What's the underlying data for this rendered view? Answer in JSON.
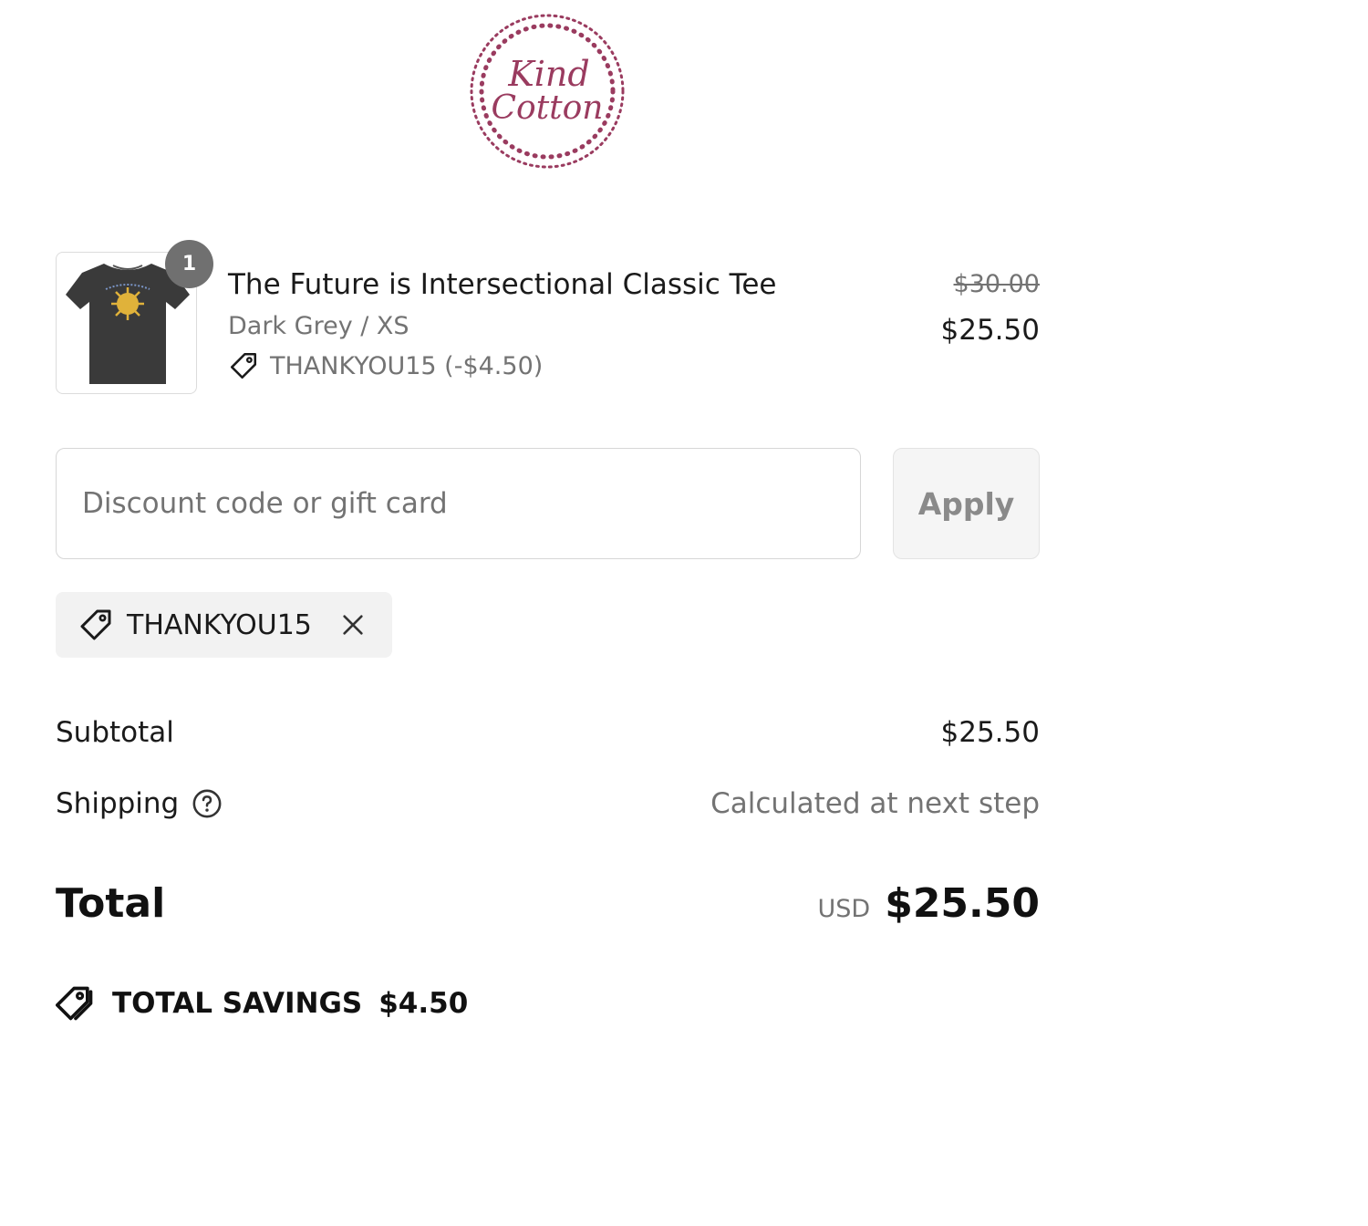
{
  "brand": {
    "logo_line1": "Kind",
    "logo_line2": "Cotton",
    "color": "#9a3b5f"
  },
  "cart": {
    "item": {
      "quantity": "1",
      "name": "The Future is Intersectional Classic Tee",
      "variant": "Dark Grey / XS",
      "discount_label": "THANKYOU15 (-$4.50)",
      "original_price": "$30.00",
      "price": "$25.50",
      "image_icon": "t-shirt-image"
    }
  },
  "discount": {
    "placeholder": "Discount code or gift card",
    "value": "",
    "apply_label": "Apply",
    "applied_code": "THANKYOU15"
  },
  "summary": {
    "subtotal_label": "Subtotal",
    "subtotal_value": "$25.50",
    "shipping_label": "Shipping",
    "shipping_value": "Calculated at next step",
    "total_label": "Total",
    "currency": "USD",
    "total_value": "$25.50",
    "savings_label": "TOTAL SAVINGS",
    "savings_value": "$4.50"
  }
}
